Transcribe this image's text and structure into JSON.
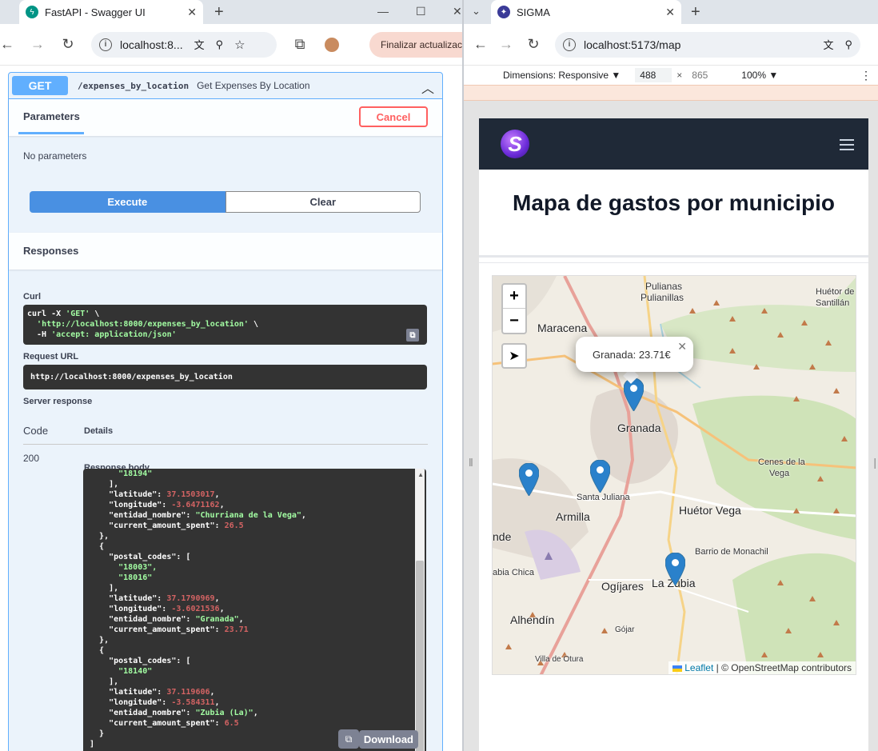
{
  "left_window": {
    "tab_title": "FastAPI - Swagger UI",
    "url": "localhost:8...",
    "update_button": "Finalizar actualización",
    "operation": {
      "method": "GET",
      "path": "/expenses_by_location",
      "summary": "Get Expenses By Location",
      "parameters_tab": "Parameters",
      "cancel_label": "Cancel",
      "no_params": "No parameters",
      "execute_label": "Execute",
      "clear_label": "Clear",
      "responses_title": "Responses",
      "curl_label": "Curl",
      "curl_line1": "curl -X ",
      "curl_get": "'GET'",
      "curl_line1_end": " \\",
      "curl_url": "'http://localhost:8000/expenses_by_location'",
      "curl_line2_end": " \\",
      "curl_line3_prefix": "  -H ",
      "curl_header": "'accept: application/json'",
      "request_url_label": "Request URL",
      "request_url": "http://localhost:8000/expenses_by_location",
      "server_response_label": "Server response",
      "code_header": "Code",
      "details_header": "Details",
      "code": "200",
      "response_body_label": "Response body",
      "download_label": "Download",
      "response_lines": [
        {
          "indent": "      ",
          "text": "\"18194\"",
          "type": "s"
        },
        {
          "indent": "    ",
          "text": "],",
          "type": "p"
        },
        {
          "indent": "    ",
          "key": "\"latitude\": ",
          "val": "37.1503017",
          "end": ",",
          "type": "n"
        },
        {
          "indent": "    ",
          "key": "\"longitude\": ",
          "val": "-3.6471162",
          "end": ",",
          "type": "n"
        },
        {
          "indent": "    ",
          "key": "\"entidad_nombre\": ",
          "val": "\"Churriana de la Vega\"",
          "end": ",",
          "type": "s"
        },
        {
          "indent": "    ",
          "key": "\"current_amount_spent\": ",
          "val": "26.5",
          "end": "",
          "type": "n"
        },
        {
          "indent": "  ",
          "text": "},",
          "type": "p"
        },
        {
          "indent": "  ",
          "text": "{",
          "type": "p"
        },
        {
          "indent": "    ",
          "text": "\"postal_codes\": [",
          "type": "p"
        },
        {
          "indent": "      ",
          "text": "\"18003\",",
          "type": "s"
        },
        {
          "indent": "      ",
          "text": "\"18016\"",
          "type": "s"
        },
        {
          "indent": "    ",
          "text": "],",
          "type": "p"
        },
        {
          "indent": "    ",
          "key": "\"latitude\": ",
          "val": "37.1790969",
          "end": ",",
          "type": "n"
        },
        {
          "indent": "    ",
          "key": "\"longitude\": ",
          "val": "-3.6021536",
          "end": ",",
          "type": "n"
        },
        {
          "indent": "    ",
          "key": "\"entidad_nombre\": ",
          "val": "\"Granada\"",
          "end": ",",
          "type": "s"
        },
        {
          "indent": "    ",
          "key": "\"current_amount_spent\": ",
          "val": "23.71",
          "end": "",
          "type": "n"
        },
        {
          "indent": "  ",
          "text": "},",
          "type": "p"
        },
        {
          "indent": "  ",
          "text": "{",
          "type": "p"
        },
        {
          "indent": "    ",
          "text": "\"postal_codes\": [",
          "type": "p"
        },
        {
          "indent": "      ",
          "text": "\"18140\"",
          "type": "s"
        },
        {
          "indent": "    ",
          "text": "],",
          "type": "p"
        },
        {
          "indent": "    ",
          "key": "\"latitude\": ",
          "val": "37.119606",
          "end": ",",
          "type": "n"
        },
        {
          "indent": "    ",
          "key": "\"longitude\": ",
          "val": "-3.584311",
          "end": ",",
          "type": "n"
        },
        {
          "indent": "    ",
          "key": "\"entidad_nombre\": ",
          "val": "\"Zubia (La)\"",
          "end": ",",
          "type": "s"
        },
        {
          "indent": "    ",
          "key": "\"current_amount_spent\": ",
          "val": "6.5",
          "end": "",
          "type": "n"
        },
        {
          "indent": "  ",
          "text": "}",
          "type": "p"
        },
        {
          "indent": "",
          "text": "]",
          "type": "p"
        }
      ]
    }
  },
  "right_window": {
    "tab_title": "SIGMA",
    "url": "localhost:5173/map",
    "devtools": {
      "dimensions_label": "Dimensions: Responsive ▼",
      "width": "488",
      "height": "865",
      "zoom": "100% ▼"
    },
    "page": {
      "logo_letter": "S",
      "title": "Mapa de gastos por municipio",
      "map": {
        "popup_text": "Granada: 23.71€",
        "attribution_leaflet": "Leaflet",
        "attribution_rest": "| © OpenStreetMap contributors",
        "places": [
          "Pulianas",
          "Pulianillas",
          "Maracena",
          "Huétor de",
          "Santillán",
          "Granada",
          "Cenes de la",
          "Vega",
          "Santa Juliana",
          "Armilla",
          "Huétor Vega",
          "nde",
          "Barrio de Monachil",
          "abia Chica",
          "Ogíjares",
          "La Zubia",
          "Alhendín",
          "Gójar",
          "Villa de Otura"
        ]
      }
    }
  }
}
